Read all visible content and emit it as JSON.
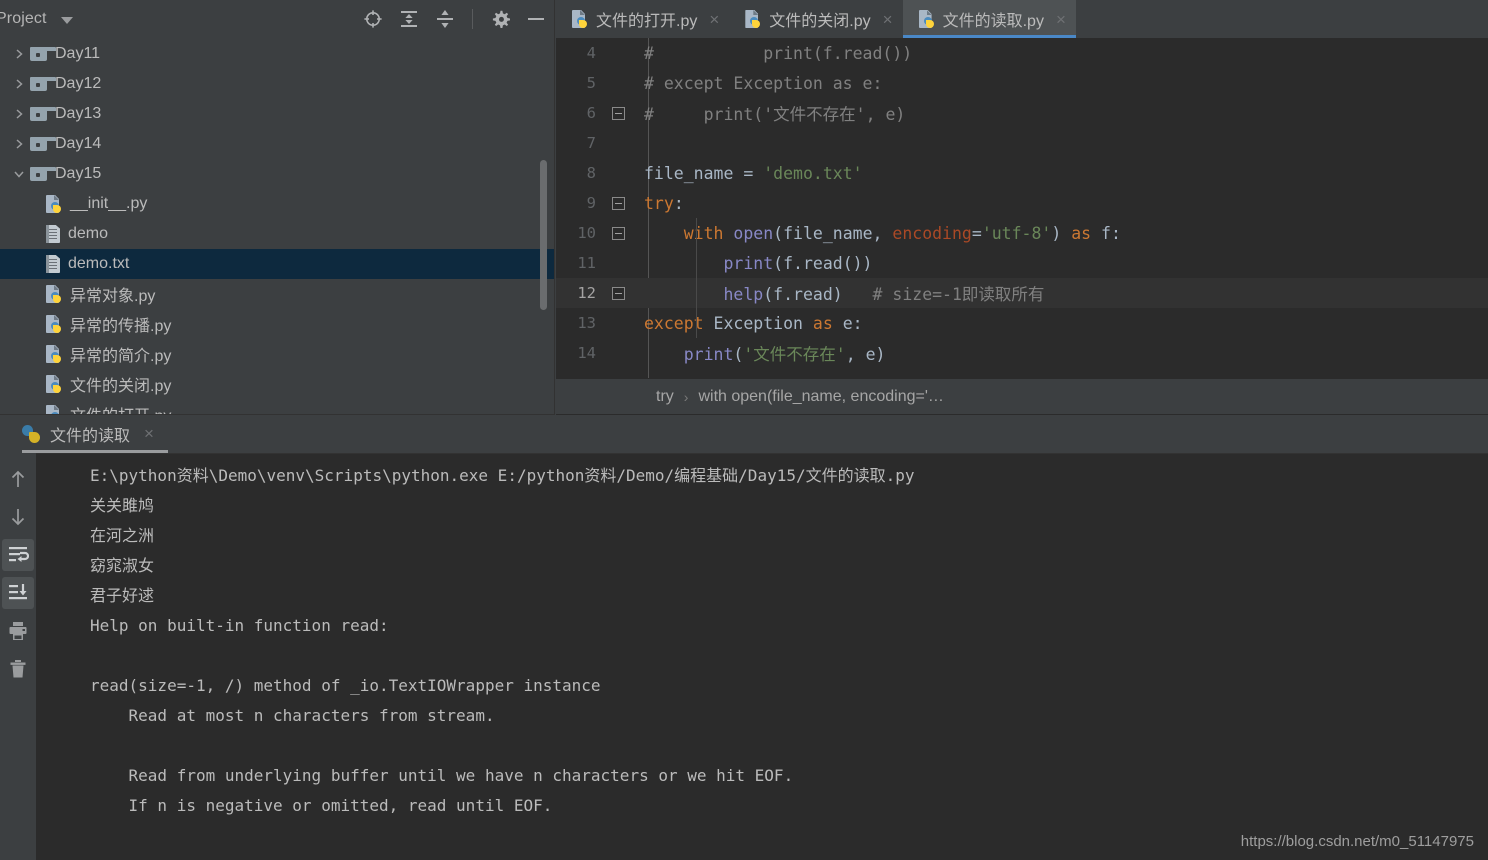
{
  "project_panel": {
    "title": "Project",
    "tools": [
      {
        "name": "locate-icon",
        "label": "Select Opened File"
      },
      {
        "name": "expand-all-icon",
        "label": "Expand All"
      },
      {
        "name": "collapse-all-icon",
        "label": "Collapse All"
      },
      {
        "name": "gear-icon",
        "label": "Settings"
      },
      {
        "name": "minimize-icon",
        "label": "Hide"
      }
    ],
    "tree": [
      {
        "label": "Day11",
        "kind": "folder",
        "expanded": false,
        "depth": 0,
        "selected": false
      },
      {
        "label": "Day12",
        "kind": "folder",
        "expanded": false,
        "depth": 0,
        "selected": false
      },
      {
        "label": "Day13",
        "kind": "folder",
        "expanded": false,
        "depth": 0,
        "selected": false
      },
      {
        "label": "Day14",
        "kind": "folder",
        "expanded": false,
        "depth": 0,
        "selected": false
      },
      {
        "label": "Day15",
        "kind": "folder",
        "expanded": true,
        "depth": 0,
        "selected": false
      },
      {
        "label": "__init__.py",
        "kind": "python",
        "depth": 1,
        "selected": false
      },
      {
        "label": "demo",
        "kind": "text",
        "depth": 1,
        "selected": false
      },
      {
        "label": "demo.txt",
        "kind": "text",
        "depth": 1,
        "selected": true
      },
      {
        "label": "异常对象.py",
        "kind": "python",
        "depth": 1,
        "selected": false
      },
      {
        "label": "异常的传播.py",
        "kind": "python",
        "depth": 1,
        "selected": false
      },
      {
        "label": "异常的简介.py",
        "kind": "python",
        "depth": 1,
        "selected": false
      },
      {
        "label": "文件的关闭.py",
        "kind": "python",
        "depth": 1,
        "selected": false
      },
      {
        "label": "文件的打开.py",
        "kind": "python",
        "depth": 1,
        "selected": false
      }
    ]
  },
  "editor": {
    "tabs": [
      {
        "label": "文件的打开.py",
        "active": false,
        "close": "×"
      },
      {
        "label": "文件的关闭.py",
        "active": false,
        "close": "×"
      },
      {
        "label": "文件的读取.py",
        "active": true,
        "close": "×"
      }
    ],
    "lines": [
      {
        "num": "4",
        "current": false,
        "fold": "",
        "tokens": [
          {
            "t": "#           print(f.read())",
            "c": "c-comment"
          }
        ]
      },
      {
        "num": "5",
        "current": false,
        "fold": "",
        "tokens": [
          {
            "t": "# except Exception as e:",
            "c": "c-comment"
          }
        ]
      },
      {
        "num": "6",
        "current": false,
        "fold": "up",
        "tokens": [
          {
            "t": "#     print('文件不存在', e)",
            "c": "c-comment"
          }
        ]
      },
      {
        "num": "7",
        "current": false,
        "fold": "",
        "tokens": []
      },
      {
        "num": "8",
        "current": false,
        "fold": "",
        "tokens": [
          {
            "t": "file_name ",
            "c": "c-ident"
          },
          {
            "t": "= ",
            "c": "c-plain"
          },
          {
            "t": "'demo.txt'",
            "c": "c-str"
          }
        ]
      },
      {
        "num": "9",
        "current": false,
        "fold": "dn",
        "tokens": [
          {
            "t": "try",
            "c": "c-kw"
          },
          {
            "t": ":",
            "c": "c-plain"
          }
        ]
      },
      {
        "num": "10",
        "current": false,
        "fold": "dn",
        "tokens": [
          {
            "t": "    ",
            "c": "c-plain"
          },
          {
            "t": "with ",
            "c": "c-kw"
          },
          {
            "t": "open",
            "c": "c-fn"
          },
          {
            "t": "(file_name, ",
            "c": "c-plain"
          },
          {
            "t": "encoding",
            "c": "c-param"
          },
          {
            "t": "=",
            "c": "c-plain"
          },
          {
            "t": "'utf-8'",
            "c": "c-str"
          },
          {
            "t": ") ",
            "c": "c-plain"
          },
          {
            "t": "as ",
            "c": "c-kw"
          },
          {
            "t": "f:",
            "c": "c-plain"
          }
        ]
      },
      {
        "num": "11",
        "current": false,
        "fold": "",
        "tokens": [
          {
            "t": "        ",
            "c": "c-plain"
          },
          {
            "t": "print",
            "c": "c-fn"
          },
          {
            "t": "(f.read())",
            "c": "c-plain"
          }
        ]
      },
      {
        "num": "12",
        "current": true,
        "fold": "end",
        "tokens": [
          {
            "t": "        ",
            "c": "c-plain"
          },
          {
            "t": "help",
            "c": "c-fn"
          },
          {
            "t": "(f.read)",
            "c": "c-plain"
          },
          {
            "t": "   # size=-1即读取所有",
            "c": "c-comment"
          }
        ]
      },
      {
        "num": "13",
        "current": false,
        "fold": "",
        "tokens": [
          {
            "t": "except ",
            "c": "c-kw"
          },
          {
            "t": "Exception ",
            "c": "c-plain"
          },
          {
            "t": "as ",
            "c": "c-kw"
          },
          {
            "t": "e:",
            "c": "c-plain"
          }
        ]
      },
      {
        "num": "14",
        "current": false,
        "fold": "",
        "tokens": [
          {
            "t": "    ",
            "c": "c-plain"
          },
          {
            "t": "print",
            "c": "c-fn"
          },
          {
            "t": "(",
            "c": "c-plain"
          },
          {
            "t": "'文件不存在'",
            "c": "c-str"
          },
          {
            "t": ", e)",
            "c": "c-plain"
          }
        ]
      }
    ],
    "breadcrumb": {
      "items": [
        "try",
        "with open(file_name, encoding='…"
      ],
      "separator": "›"
    }
  },
  "run_panel": {
    "tab": {
      "label": "文件的读取",
      "close": "×"
    },
    "tools": [
      {
        "name": "arrow-up-icon",
        "active": false
      },
      {
        "name": "arrow-down-icon",
        "active": false
      },
      {
        "name": "soft-wrap-icon",
        "active": true
      },
      {
        "name": "scroll-to-end-icon",
        "active": true
      },
      {
        "name": "print-icon",
        "active": false
      },
      {
        "name": "trash-icon",
        "active": false
      }
    ],
    "output": [
      "E:\\python资料\\Demo\\venv\\Scripts\\python.exe E:/python资料/Demo/编程基础/Day15/文件的读取.py",
      "关关雎鸠",
      "在河之洲",
      "窈窕淑女",
      "君子好逑",
      "Help on built-in function read:",
      "",
      "read(size=-1, /) method of _io.TextIOWrapper instance",
      "    Read at most n characters from stream.",
      "",
      "    Read from underlying buffer until we have n characters or we hit EOF.",
      "    If n is negative or omitted, read until EOF."
    ]
  },
  "watermark": "https://blog.csdn.net/m0_51147975",
  "colors": {
    "panel_bg": "#3c3f41",
    "editor_bg": "#2b2b2b",
    "selection_bg": "#0d293e",
    "tab_active_bg": "#4e5254",
    "tab_accent": "#4a88c7",
    "text": "#bbbbbb",
    "keyword": "#cc7832",
    "string": "#6a8759",
    "function": "#8888c6",
    "comment": "#808080",
    "param": "#aa4926"
  }
}
